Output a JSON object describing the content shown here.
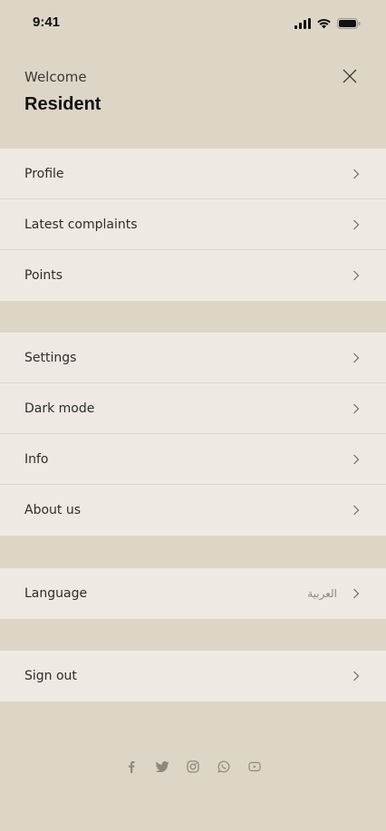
{
  "status_bar": {
    "time": "9:41"
  },
  "header": {
    "welcome": "Welcome",
    "user": "Resident"
  },
  "groups": [
    {
      "items": [
        {
          "label": "Profile"
        },
        {
          "label": "Latest complaints"
        },
        {
          "label": "Points"
        }
      ]
    },
    {
      "items": [
        {
          "label": "Settings"
        },
        {
          "label": "Dark mode"
        },
        {
          "label": "Info"
        },
        {
          "label": "About us"
        }
      ]
    },
    {
      "items": [
        {
          "label": "Language",
          "value": "العربية"
        }
      ]
    },
    {
      "items": [
        {
          "label": "Sign out"
        }
      ]
    }
  ],
  "social": [
    "facebook-icon",
    "twitter-icon",
    "instagram-icon",
    "whatsapp-icon",
    "youtube-icon"
  ],
  "colors": {
    "background": "#DDD6C7",
    "row": "#EEEAE3",
    "divider": "#DCD5C8",
    "icon": "#8D887F"
  }
}
